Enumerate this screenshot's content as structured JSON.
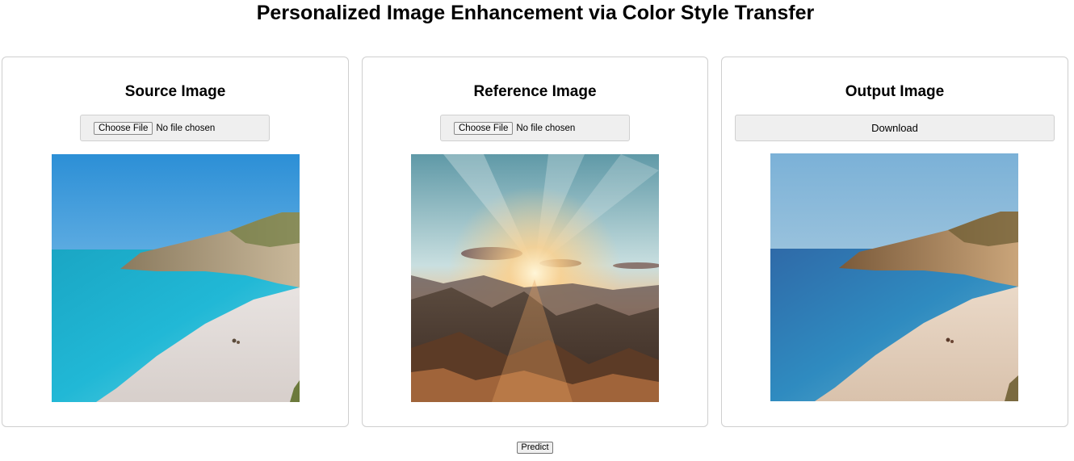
{
  "page": {
    "title": "Personalized Image Enhancement via Color Style Transfer"
  },
  "source": {
    "title": "Source Image",
    "choose_label": "Choose File",
    "file_status": "No file chosen",
    "image_icon": "beach-photo"
  },
  "reference": {
    "title": "Reference Image",
    "choose_label": "Choose File",
    "file_status": "No file chosen",
    "image_icon": "sunset-mountain-photo"
  },
  "output": {
    "title": "Output Image",
    "download_label": "Download",
    "image_icon": "stylized-beach-photo"
  },
  "actions": {
    "predict_label": "Predict"
  }
}
